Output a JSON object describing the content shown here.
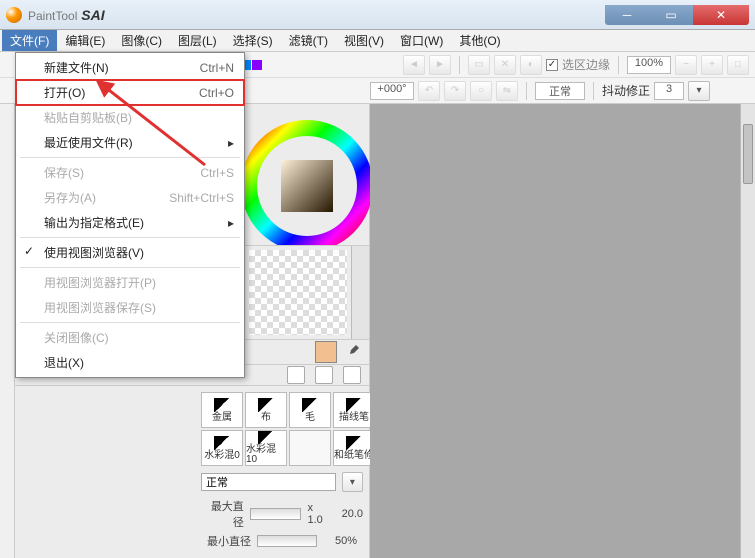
{
  "app": {
    "name_prefix": "PaintTool",
    "name_main": " SAI"
  },
  "menubar": {
    "items": [
      {
        "label": "文件(F)",
        "open": true
      },
      {
        "label": "编辑(E)"
      },
      {
        "label": "图像(C)"
      },
      {
        "label": "图层(L)"
      },
      {
        "label": "选择(S)"
      },
      {
        "label": "滤镜(T)"
      },
      {
        "label": "视图(V)"
      },
      {
        "label": "窗口(W)"
      },
      {
        "label": "其他(O)"
      }
    ]
  },
  "file_menu": {
    "new": {
      "label": "新建文件(N)",
      "shortcut": "Ctrl+N"
    },
    "open": {
      "label": "打开(O)",
      "shortcut": "Ctrl+O"
    },
    "paste_new": {
      "label": "粘贴自剪贴板(B)"
    },
    "recent": {
      "label": "最近使用文件(R)"
    },
    "save": {
      "label": "保存(S)",
      "shortcut": "Ctrl+S"
    },
    "saveas": {
      "label": "另存为(A)",
      "shortcut": "Shift+Ctrl+S"
    },
    "export": {
      "label": "输出为指定格式(E)"
    },
    "viewer": {
      "label": "使用视图浏览器(V)"
    },
    "viewer_open": {
      "label": "用视图浏览器打开(P)"
    },
    "viewer_save": {
      "label": "用视图浏览器保存(S)"
    },
    "close": {
      "label": "关闭图像(C)"
    },
    "exit": {
      "label": "退出(X)"
    }
  },
  "toolbar2": {
    "sel_edge_label": "选区边缘",
    "zoom": "100%",
    "angle": "+000°",
    "blend_mode": "正常",
    "stabilizer_label": "抖动修正",
    "stabilizer_value": "3"
  },
  "brushes": [
    {
      "name": "金属"
    },
    {
      "name": "布"
    },
    {
      "name": "毛"
    },
    {
      "name": "描线笔"
    },
    {
      "name": "水彩混0"
    },
    {
      "name": "水彩混10"
    },
    {
      "name": ""
    },
    {
      "name": "和纸笔修"
    }
  ],
  "brush_mode": "正常",
  "params": {
    "max_size_label": "最大直径",
    "max_size_x": "x 1.0",
    "max_size_val": "20.0",
    "min_size_label": "最小直径",
    "min_size_val": "50%"
  },
  "swatches": [
    "#000",
    "#888",
    "#c00",
    "#f80",
    "#0c0",
    "#08f",
    "#80f"
  ]
}
